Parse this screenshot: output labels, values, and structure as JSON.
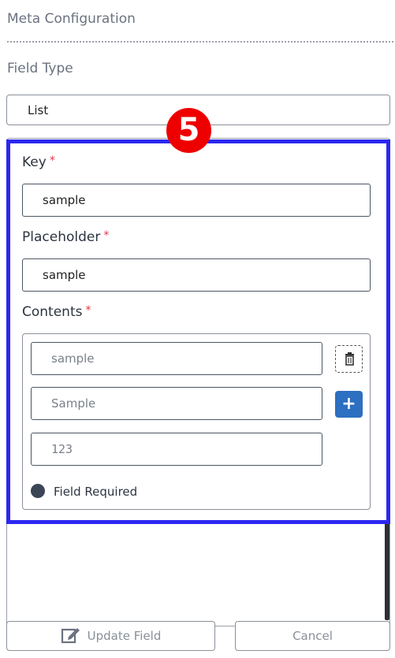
{
  "section": {
    "title": "Meta Configuration"
  },
  "field_type": {
    "label": "Field Type",
    "value": "List"
  },
  "annotation": {
    "badge": "5",
    "highlight_color": "#2b27f0",
    "badge_color": "#ee0000"
  },
  "form": {
    "key": {
      "label": "Key",
      "required_mark": "*",
      "value": "sample"
    },
    "placeholder": {
      "label": "Placeholder",
      "required_mark": "*",
      "value": "sample"
    },
    "contents": {
      "label": "Contents",
      "required_mark": "*",
      "items": [
        "sample",
        "Sample",
        "123"
      ],
      "field_required_label": "Field Required"
    }
  },
  "footer": {
    "update_label": "Update Field",
    "cancel_label": "Cancel"
  },
  "colors": {
    "accent": "#2d6fc0",
    "required": "#dc3545"
  }
}
